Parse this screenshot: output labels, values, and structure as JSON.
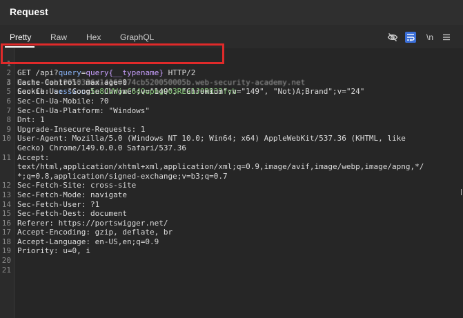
{
  "panel": {
    "title": "Request"
  },
  "tabs": [
    {
      "label": "Pretty",
      "active": true
    },
    {
      "label": "Raw",
      "active": false
    },
    {
      "label": "Hex",
      "active": false
    },
    {
      "label": "GraphQL",
      "active": false
    }
  ],
  "toolbar": {
    "newline_label": "\\n",
    "icons": [
      "eye-off-icon",
      "wrap-text-icon",
      "newline-toggle",
      "menu-icon"
    ]
  },
  "colors": {
    "highlight_border": "#e02a2a",
    "active_tool": "#3b6fd8"
  },
  "request_lines": [
    {
      "n": "1",
      "method": "GET",
      "path": "/api?",
      "param_name": "query",
      "eq": "=",
      "param_value": "query{__typename}",
      "proto": "HTTP/2"
    },
    {
      "n": "2",
      "text": "Host: 0ab10050336d14160174cb520050005b.web-security-academy.net"
    },
    {
      "n": "3",
      "key": "Cookie: ",
      "cookie_name": "session",
      "cookie_eq": "=",
      "cookie_value": "5n8JVWjwC64QupbgQ03REa1J9RR33fvh"
    },
    {
      "n": "4",
      "text": "Cache-Control: max-age=0"
    },
    {
      "n": "5",
      "text": "Sec-Ch-Ua: \"Google Chrome\";v=\"149\", \"Chromium\";v=\"149\", \"Not)A;Brand\";v=\"24\""
    },
    {
      "n": "6",
      "text": "Sec-Ch-Ua-Mobile: ?0"
    },
    {
      "n": "7",
      "text": "Sec-Ch-Ua-Platform: \"Windows\""
    },
    {
      "n": "8",
      "text": "Dnt: 1"
    },
    {
      "n": "9",
      "text": "Upgrade-Insecure-Requests: 1"
    },
    {
      "n": "10",
      "text": "User-Agent: Mozilla/5.0 (Windows NT 10.0; Win64; x64) AppleWebKit/537.36 (KHTML, like"
    },
    {
      "n": "",
      "text": "Gecko) Chrome/149.0.0.0 Safari/537.36"
    },
    {
      "n": "11",
      "text": "Accept:"
    },
    {
      "n": "",
      "text": "text/html,application/xhtml+xml,application/xml;q=0.9,image/avif,image/webp,image/apng,*/"
    },
    {
      "n": "",
      "text": "*;q=0.8,application/signed-exchange;v=b3;q=0.7"
    },
    {
      "n": "12",
      "text": "Sec-Fetch-Site: cross-site"
    },
    {
      "n": "13",
      "text": "Sec-Fetch-Mode: navigate"
    },
    {
      "n": "14",
      "text": "Sec-Fetch-User: ?1"
    },
    {
      "n": "15",
      "text": "Sec-Fetch-Dest: document"
    },
    {
      "n": "16",
      "text": "Referer: https://portswigger.net/"
    },
    {
      "n": "17",
      "text": "Accept-Encoding: gzip, deflate, br"
    },
    {
      "n": "18",
      "text": "Accept-Language: en-US,en;q=0.9"
    },
    {
      "n": "19",
      "text": "Priority: u=0, i"
    },
    {
      "n": "20",
      "text": ""
    },
    {
      "n": "21",
      "text": ""
    }
  ]
}
